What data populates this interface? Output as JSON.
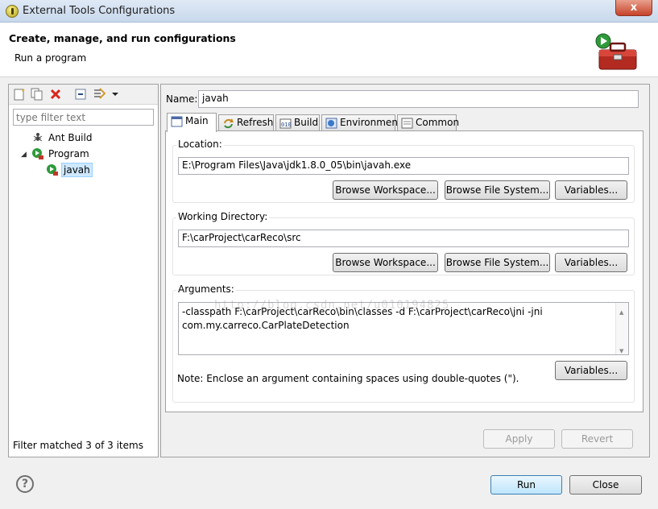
{
  "window": {
    "title": "External Tools Configurations",
    "close_glyph": "x"
  },
  "header": {
    "title": "Create, manage, and run configurations",
    "subtitle": "Run a program",
    "icon": "toolbox-run-icon"
  },
  "left_panel": {
    "toolbar": [
      "new-configuration-icon",
      "duplicate-icon",
      "delete-icon",
      "collapse-all-icon",
      "filter-icon",
      "view-menu-icon"
    ],
    "filter_placeholder": "type filter text",
    "tree": [
      {
        "label": "Ant Build",
        "icon": "ant-icon"
      },
      {
        "label": "Program",
        "icon": "program-run-icon",
        "expander": "◢"
      },
      {
        "label": "javah",
        "icon": "program-run-icon",
        "selected": true
      }
    ],
    "status": "Filter matched 3 of 3 items"
  },
  "right_panel": {
    "name_label": "Name:",
    "name_value": "javah",
    "tabs": [
      {
        "label": "Main",
        "icon": "main-tab-icon",
        "active": true
      },
      {
        "label": "Refresh",
        "icon": "refresh-icon"
      },
      {
        "label": "Build",
        "icon": "build-icon"
      },
      {
        "label": "Environment",
        "icon": "environment-icon"
      },
      {
        "label": "Common",
        "icon": "common-icon"
      }
    ],
    "location": {
      "label": "Location:",
      "value": "E:\\Program Files\\Java\\jdk1.8.0_05\\bin\\javah.exe",
      "buttons": [
        "Browse Workspace...",
        "Browse File System...",
        "Variables..."
      ]
    },
    "working_directory": {
      "label": "Working Directory:",
      "value": "F:\\carProject\\carReco\\src",
      "buttons": [
        "Browse Workspace...",
        "Browse File System...",
        "Variables..."
      ]
    },
    "arguments": {
      "label": "Arguments:",
      "lines": [
        "-classpath F:\\carProject\\carReco\\bin\\classes -d F:\\carProject\\carReco\\jni -jni",
        "com.my.carreco.CarPlateDetection"
      ],
      "variables_button": "Variables..."
    },
    "note": "Note: Enclose an argument containing spaces using double-quotes (\").",
    "watermark": "http://blog.csdn.net/u010194825",
    "apply_label": "Apply",
    "revert_label": "Revert"
  },
  "footer": {
    "help_glyph": "?",
    "run_label": "Run",
    "close_label": "Close"
  }
}
